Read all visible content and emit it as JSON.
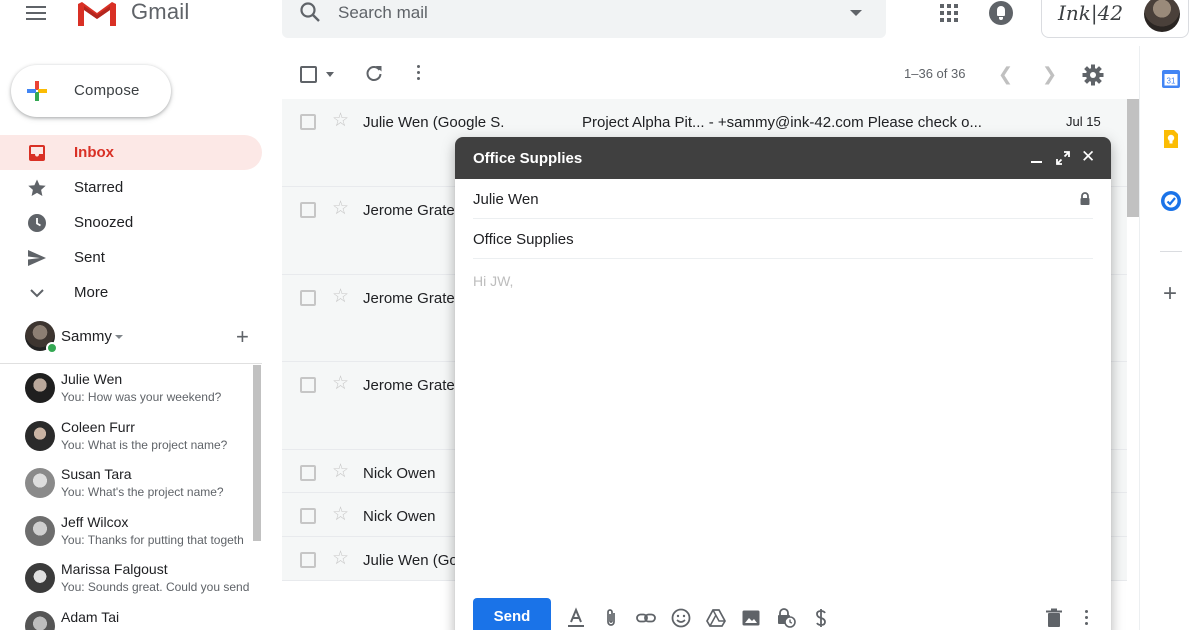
{
  "app": {
    "name": "Gmail"
  },
  "search": {
    "placeholder": "Search mail"
  },
  "account": {
    "brand": "Ink|42"
  },
  "compose_button": {
    "label": "Compose"
  },
  "nav": {
    "items": [
      {
        "label": "Inbox",
        "icon": "inbox-icon",
        "active": true
      },
      {
        "label": "Starred",
        "icon": "star-icon"
      },
      {
        "label": "Snoozed",
        "icon": "clock-icon"
      },
      {
        "label": "Sent",
        "icon": "send-icon"
      },
      {
        "label": "More",
        "icon": "chevron-down-icon"
      }
    ]
  },
  "hangouts": {
    "user": "Sammy",
    "contacts": [
      {
        "name": "Julie Wen",
        "message": "You: How was your weekend?"
      },
      {
        "name": "Coleen Furr",
        "message": "You: What is the project name?"
      },
      {
        "name": "Susan Tara",
        "message": "You: What's the project name?"
      },
      {
        "name": "Jeff Wilcox",
        "message": "You: Thanks for putting that togeth"
      },
      {
        "name": "Marissa Falgoust",
        "message": "You: Sounds great. Could you send"
      },
      {
        "name": "Adam Tai",
        "message": ""
      }
    ]
  },
  "toolbar": {
    "count": "1–36 of 36"
  },
  "emails": [
    {
      "sender": "Julie Wen (Google S.",
      "subject": "Project Alpha Pit... - +sammy@ink-42.com Please check o...",
      "date": "Jul 15"
    },
    {
      "sender": "Jerome Grate",
      "subject": "",
      "date": ""
    },
    {
      "sender": "Jerome Grate",
      "subject": "",
      "date": ""
    },
    {
      "sender": "Jerome Grate",
      "subject": "",
      "date": ""
    },
    {
      "sender": "Nick Owen",
      "subject": "",
      "date": ""
    },
    {
      "sender": "Nick Owen",
      "subject": "",
      "date": ""
    },
    {
      "sender": "Julie Wen (Go",
      "subject": "",
      "date": ""
    }
  ],
  "compose_window": {
    "title": "Office Supplies",
    "to": "Julie Wen",
    "subject": "Office Supplies",
    "body": "Hi JW,",
    "send_label": "Send"
  },
  "colors": {
    "accent": "#1a73e8",
    "gmail_red": "#d93025",
    "active_nav_bg": "#fce8e6",
    "compose_header": "#404040"
  }
}
